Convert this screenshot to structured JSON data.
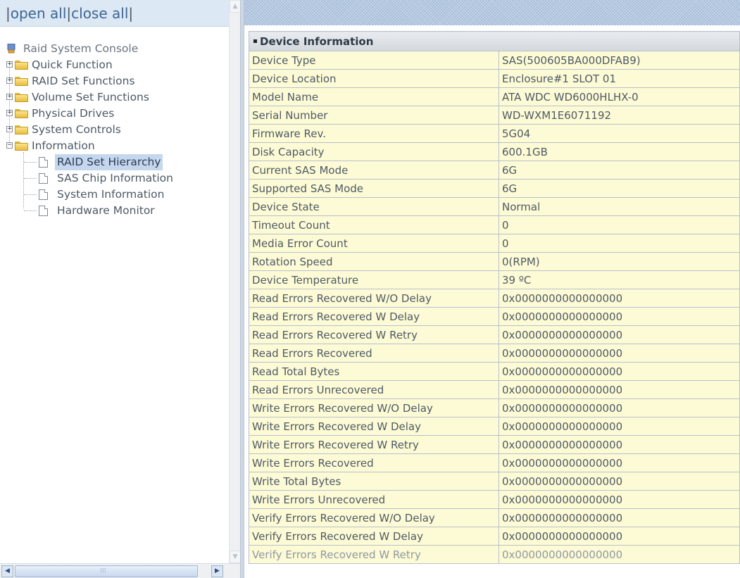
{
  "left_panel": {
    "links": {
      "open_all": "open all",
      "close_all": "close all"
    },
    "tree": {
      "root": "Raid System Console",
      "folders": [
        {
          "label": "Quick Function",
          "expanded": false
        },
        {
          "label": "RAID Set Functions",
          "expanded": false
        },
        {
          "label": "Volume Set Functions",
          "expanded": false
        },
        {
          "label": "Physical Drives",
          "expanded": false
        },
        {
          "label": "System Controls",
          "expanded": false
        },
        {
          "label": "Information",
          "expanded": true
        }
      ],
      "information_items": [
        {
          "label": "RAID Set Hierarchy",
          "selected": true
        },
        {
          "label": "SAS Chip Information",
          "selected": false
        },
        {
          "label": "System Information",
          "selected": false
        },
        {
          "label": "Hardware Monitor",
          "selected": false
        }
      ]
    }
  },
  "device_info": {
    "title": "Device Information",
    "rows": [
      {
        "label": "Device Type",
        "value": "SAS(500605BA000DFAB9)"
      },
      {
        "label": "Device Location",
        "value": "Enclosure#1 SLOT 01"
      },
      {
        "label": "Model Name",
        "value": "ATA WDC WD6000HLHX-0"
      },
      {
        "label": "Serial Number",
        "value": "WD-WXM1E6071192"
      },
      {
        "label": "Firmware Rev.",
        "value": "5G04"
      },
      {
        "label": "Disk Capacity",
        "value": "600.1GB"
      },
      {
        "label": "Current SAS Mode",
        "value": "6G"
      },
      {
        "label": "Supported SAS Mode",
        "value": "6G"
      },
      {
        "label": "Device State",
        "value": "Normal"
      },
      {
        "label": "Timeout Count",
        "value": "0"
      },
      {
        "label": "Media Error Count",
        "value": "0"
      },
      {
        "label": "Rotation Speed",
        "value": "0(RPM)"
      },
      {
        "label": "Device Temperature",
        "value": "39 ºC"
      },
      {
        "label": "Read Errors Recovered W/O Delay",
        "value": "0x0000000000000000"
      },
      {
        "label": "Read Errors Recovered W Delay",
        "value": "0x0000000000000000"
      },
      {
        "label": "Read Errors Recovered W Retry",
        "value": "0x0000000000000000"
      },
      {
        "label": "Read Errors Recovered",
        "value": "0x0000000000000000"
      },
      {
        "label": "Read Total Bytes",
        "value": "0x0000000000000000"
      },
      {
        "label": "Read Errors Unrecovered",
        "value": "0x0000000000000000"
      },
      {
        "label": "Write Errors Recovered W/O Delay",
        "value": "0x0000000000000000"
      },
      {
        "label": "Write Errors Recovered W Delay",
        "value": "0x0000000000000000"
      },
      {
        "label": "Write Errors Recovered W Retry",
        "value": "0x0000000000000000"
      },
      {
        "label": "Write Errors Recovered",
        "value": "0x0000000000000000"
      },
      {
        "label": "Write Total Bytes",
        "value": "0x0000000000000000"
      },
      {
        "label": "Write Errors Unrecovered",
        "value": "0x0000000000000000"
      },
      {
        "label": "Verify Errors Recovered W/O Delay",
        "value": "0x0000000000000000"
      },
      {
        "label": "Verify Errors Recovered W Delay",
        "value": "0x0000000000000000"
      },
      {
        "label": "Verify Errors Recovered W Retry",
        "value": "0x0000000000000000"
      }
    ]
  },
  "colors": {
    "row_background": "#fdfbd5",
    "selected_item": "#c5d7ee",
    "link_color": "#3d6694"
  },
  "icons": {
    "root": "raid-console-icon",
    "folder": "folder-icon",
    "page": "document-icon",
    "expander_plus": "plus-box-icon",
    "expander_minus": "minus-box-icon"
  }
}
